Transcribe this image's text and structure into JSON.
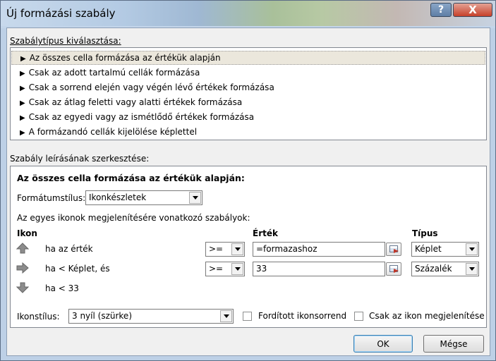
{
  "window": {
    "title": "Új formázási szabály",
    "help_label": "?",
    "close_label": "X"
  },
  "ruletype": {
    "label": "Szabálytípus kiválasztása:",
    "items": [
      {
        "label": "Az összes cella formázása az értékük alapján",
        "selected": true
      },
      {
        "label": "Csak az adott tartalmú cellák formázása"
      },
      {
        "label": "Csak a sorrend elején vagy végén lévő értékek formázása"
      },
      {
        "label": "Csak az átlag feletti vagy alatti értékek formázása"
      },
      {
        "label": "Csak az egyedi vagy az ismétlődő értékek formázása"
      },
      {
        "label": "A formázandó cellák kijelölése képlettel"
      }
    ]
  },
  "description": {
    "label": "Szabály leírásának szerkesztése:",
    "heading": "Az összes cella formázása az értékük alapján:",
    "format_style_label": "Formátumstílus:",
    "format_style_value": "Ikonkészletek",
    "rules_caption": "Az egyes ikonok megjelenítésére vonatkozó szabályok:",
    "col_icon": "Ikon",
    "col_value": "Érték",
    "col_type": "Típus",
    "rows": [
      {
        "icon": "arrow-up-icon",
        "text": "ha az érték",
        "operator": ">=",
        "value": "=formazashoz",
        "type": "Képlet"
      },
      {
        "icon": "arrow-right-icon",
        "text": "ha < Képlet, és",
        "operator": ">=",
        "value": "33",
        "type": "Százalék"
      },
      {
        "icon": "arrow-down-icon",
        "text": "ha < 33"
      }
    ],
    "icon_style_label": "Ikonstílus:",
    "icon_style_value": "3 nyíl (szürke)",
    "reverse_order_label": "Fordított ikonsorrend",
    "icon_only_label": "Csak az ikon megjelenítése"
  },
  "buttons": {
    "ok": "OK",
    "cancel": "Mégse"
  },
  "colors": {
    "icon_gray": "#8c8c8c",
    "selection": "#ebe7dc"
  }
}
